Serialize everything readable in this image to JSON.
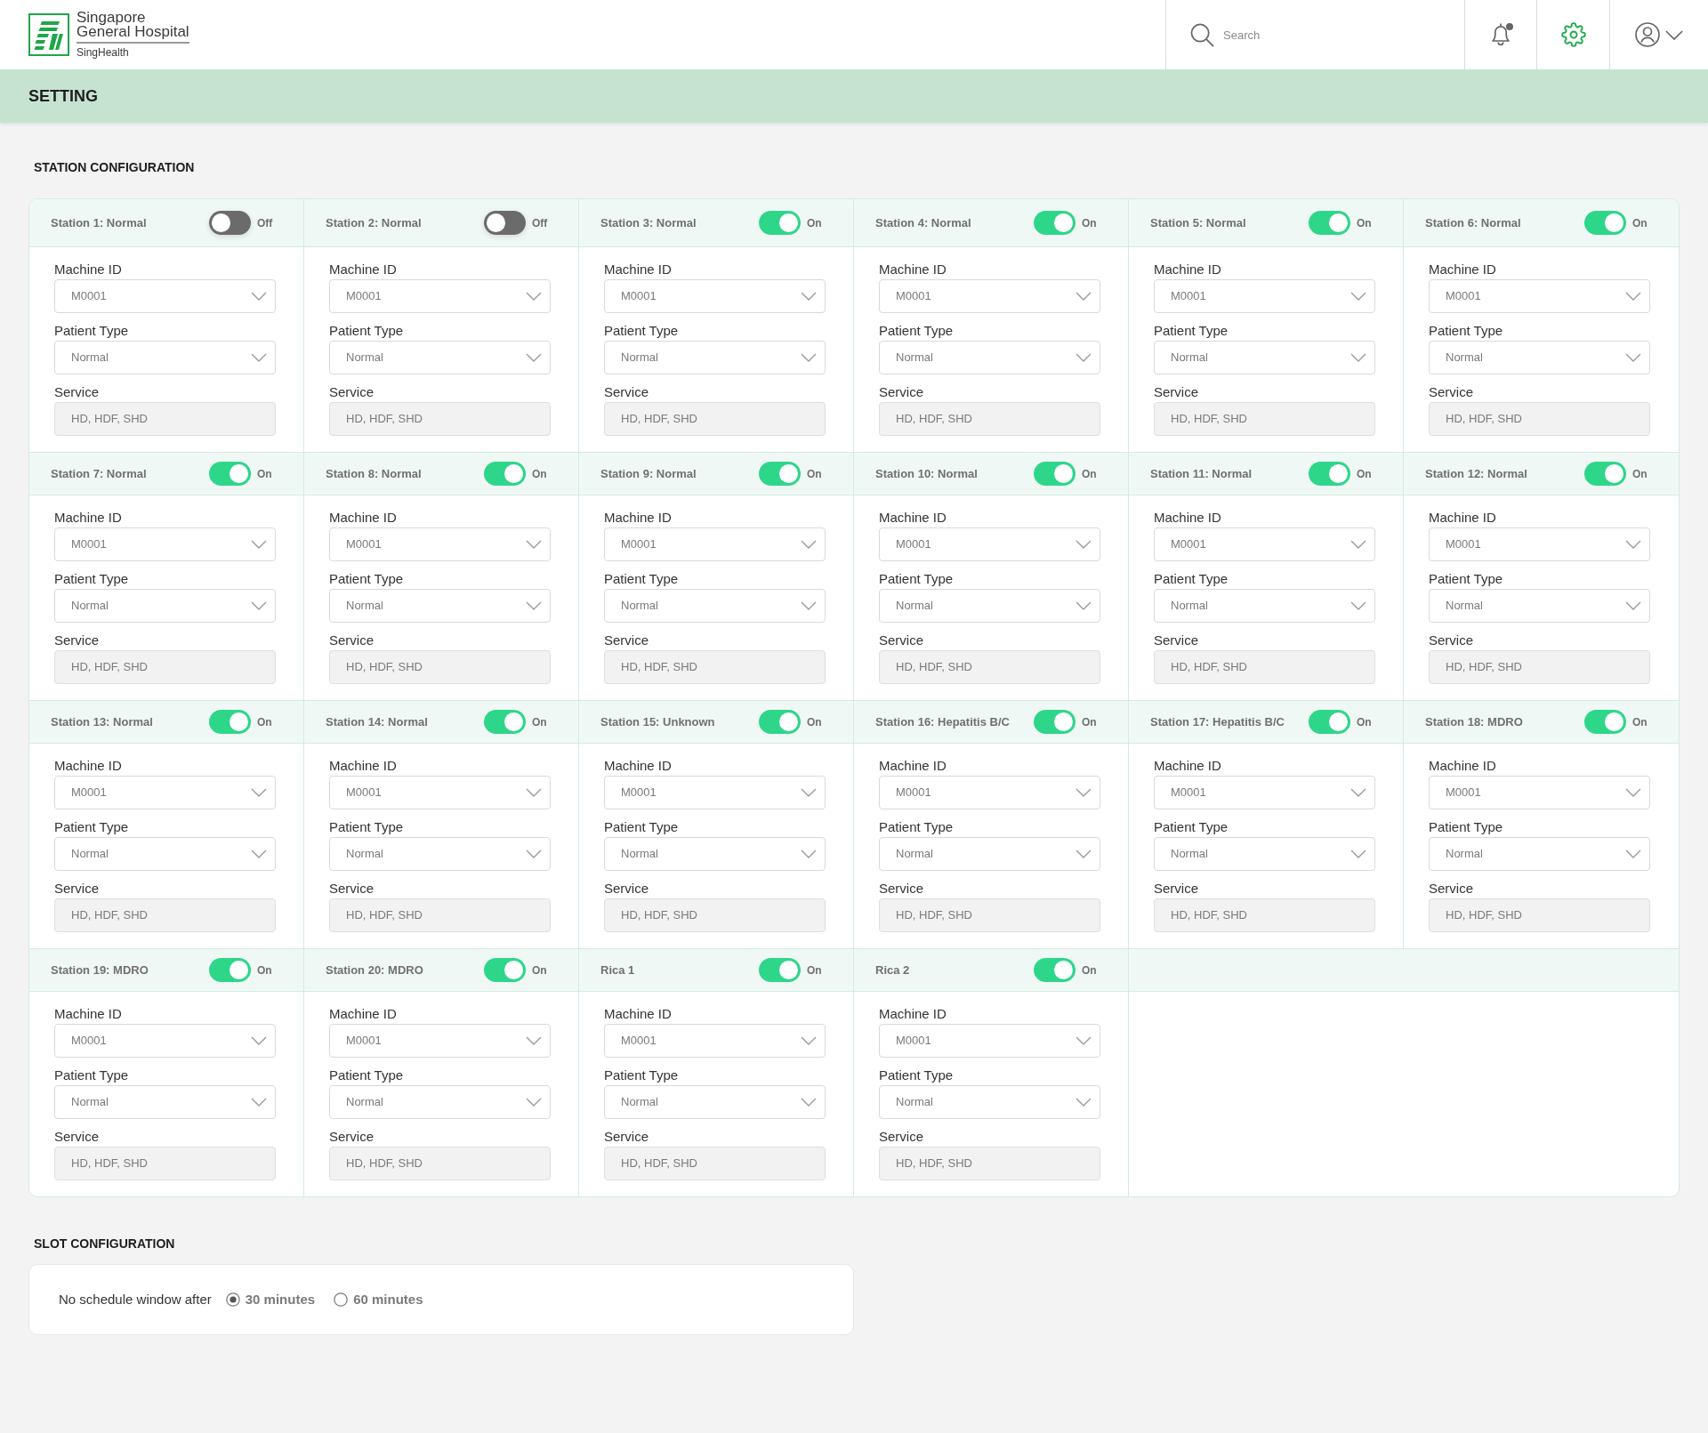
{
  "header": {
    "logo": {
      "name_lines": [
        "Singapore",
        "General Hospital"
      ],
      "group": "SingHealth"
    },
    "search": {
      "placeholder": "Search"
    },
    "actions": [
      {
        "kind": "notifications",
        "selected": false,
        "unread": true
      },
      {
        "kind": "settings",
        "selected": true,
        "unread": false
      },
      {
        "kind": "account",
        "selected": false,
        "unread": false
      }
    ]
  },
  "page_title": "SETTING",
  "station_configuration": {
    "title": "STATION CONFIGURATION",
    "stations": [
      {
        "name": "Station 1: Normal",
        "on": false,
        "toggle_label": "Off",
        "fields": [
          {
            "kind": "select",
            "label": "Machine ID",
            "value": "M0001"
          },
          {
            "kind": "select",
            "label": "Patient Type",
            "value": "Normal"
          },
          {
            "kind": "readonly",
            "label": "Service",
            "value": "HD, HDF, SHD"
          }
        ]
      },
      {
        "name": "Station 2: Normal",
        "on": false,
        "toggle_label": "Off",
        "fields": [
          {
            "kind": "select",
            "label": "Machine ID",
            "value": "M0001"
          },
          {
            "kind": "select",
            "label": "Patient Type",
            "value": "Normal"
          },
          {
            "kind": "readonly",
            "label": "Service",
            "value": "HD, HDF, SHD"
          }
        ]
      },
      {
        "name": "Station 3: Normal",
        "on": true,
        "toggle_label": "On",
        "fields": [
          {
            "kind": "select",
            "label": "Machine ID",
            "value": "M0001"
          },
          {
            "kind": "select",
            "label": "Patient Type",
            "value": "Normal"
          },
          {
            "kind": "readonly",
            "label": "Service",
            "value": "HD, HDF, SHD"
          }
        ]
      },
      {
        "name": "Station 4: Normal",
        "on": true,
        "toggle_label": "On",
        "fields": [
          {
            "kind": "select",
            "label": "Machine ID",
            "value": "M0001"
          },
          {
            "kind": "select",
            "label": "Patient Type",
            "value": "Normal"
          },
          {
            "kind": "readonly",
            "label": "Service",
            "value": "HD, HDF, SHD"
          }
        ]
      },
      {
        "name": "Station 5: Normal",
        "on": true,
        "toggle_label": "On",
        "fields": [
          {
            "kind": "select",
            "label": "Machine ID",
            "value": "M0001"
          },
          {
            "kind": "select",
            "label": "Patient Type",
            "value": "Normal"
          },
          {
            "kind": "readonly",
            "label": "Service",
            "value": "HD, HDF, SHD"
          }
        ]
      },
      {
        "name": "Station 6: Normal",
        "on": true,
        "toggle_label": "On",
        "fields": [
          {
            "kind": "select",
            "label": "Machine ID",
            "value": "M0001"
          },
          {
            "kind": "select",
            "label": "Patient Type",
            "value": "Normal"
          },
          {
            "kind": "readonly",
            "label": "Service",
            "value": "HD, HDF, SHD"
          }
        ]
      },
      {
        "name": "Station 7: Normal",
        "on": true,
        "toggle_label": "On",
        "fields": [
          {
            "kind": "select",
            "label": "Machine ID",
            "value": "M0001"
          },
          {
            "kind": "select",
            "label": "Patient Type",
            "value": "Normal"
          },
          {
            "kind": "readonly",
            "label": "Service",
            "value": "HD, HDF, SHD"
          }
        ]
      },
      {
        "name": "Station 8: Normal",
        "on": true,
        "toggle_label": "On",
        "fields": [
          {
            "kind": "select",
            "label": "Machine ID",
            "value": "M0001"
          },
          {
            "kind": "select",
            "label": "Patient Type",
            "value": "Normal"
          },
          {
            "kind": "readonly",
            "label": "Service",
            "value": "HD, HDF, SHD"
          }
        ]
      },
      {
        "name": "Station 9: Normal",
        "on": true,
        "toggle_label": "On",
        "fields": [
          {
            "kind": "select",
            "label": "Machine ID",
            "value": "M0001"
          },
          {
            "kind": "select",
            "label": "Patient Type",
            "value": "Normal"
          },
          {
            "kind": "readonly",
            "label": "Service",
            "value": "HD, HDF, SHD"
          }
        ]
      },
      {
        "name": "Station 10: Normal",
        "on": true,
        "toggle_label": "On",
        "fields": [
          {
            "kind": "select",
            "label": "Machine ID",
            "value": "M0001"
          },
          {
            "kind": "select",
            "label": "Patient Type",
            "value": "Normal"
          },
          {
            "kind": "readonly",
            "label": "Service",
            "value": "HD, HDF, SHD"
          }
        ]
      },
      {
        "name": "Station 11: Normal",
        "on": true,
        "toggle_label": "On",
        "fields": [
          {
            "kind": "select",
            "label": "Machine ID",
            "value": "M0001"
          },
          {
            "kind": "select",
            "label": "Patient Type",
            "value": "Normal"
          },
          {
            "kind": "readonly",
            "label": "Service",
            "value": "HD, HDF, SHD"
          }
        ]
      },
      {
        "name": "Station 12: Normal",
        "on": true,
        "toggle_label": "On",
        "fields": [
          {
            "kind": "select",
            "label": "Machine ID",
            "value": "M0001"
          },
          {
            "kind": "select",
            "label": "Patient Type",
            "value": "Normal"
          },
          {
            "kind": "readonly",
            "label": "Service",
            "value": "HD, HDF, SHD"
          }
        ]
      },
      {
        "name": "Station 13: Normal",
        "on": true,
        "toggle_label": "On",
        "fields": [
          {
            "kind": "select",
            "label": "Machine ID",
            "value": "M0001"
          },
          {
            "kind": "select",
            "label": "Patient Type",
            "value": "Normal"
          },
          {
            "kind": "readonly",
            "label": "Service",
            "value": "HD, HDF, SHD"
          }
        ]
      },
      {
        "name": "Station 14: Normal",
        "on": true,
        "toggle_label": "On",
        "fields": [
          {
            "kind": "select",
            "label": "Machine ID",
            "value": "M0001"
          },
          {
            "kind": "select",
            "label": "Patient Type",
            "value": "Normal"
          },
          {
            "kind": "readonly",
            "label": "Service",
            "value": "HD, HDF, SHD"
          }
        ]
      },
      {
        "name": "Station 15: Unknown",
        "on": true,
        "toggle_label": "On",
        "fields": [
          {
            "kind": "select",
            "label": "Machine ID",
            "value": "M0001"
          },
          {
            "kind": "select",
            "label": "Patient Type",
            "value": "Normal"
          },
          {
            "kind": "readonly",
            "label": "Service",
            "value": "HD, HDF, SHD"
          }
        ]
      },
      {
        "name": "Station 16: Hepatitis B/C",
        "on": true,
        "toggle_label": "On",
        "fields": [
          {
            "kind": "select",
            "label": "Machine ID",
            "value": "M0001"
          },
          {
            "kind": "select",
            "label": "Patient Type",
            "value": "Normal"
          },
          {
            "kind": "readonly",
            "label": "Service",
            "value": "HD, HDF, SHD"
          }
        ]
      },
      {
        "name": "Station 17: Hepatitis B/C",
        "on": true,
        "toggle_label": "On",
        "fields": [
          {
            "kind": "select",
            "label": "Machine ID",
            "value": "M0001"
          },
          {
            "kind": "select",
            "label": "Patient Type",
            "value": "Normal"
          },
          {
            "kind": "readonly",
            "label": "Service",
            "value": "HD, HDF, SHD"
          }
        ]
      },
      {
        "name": "Station 18: MDRO",
        "on": true,
        "toggle_label": "On",
        "fields": [
          {
            "kind": "select",
            "label": "Machine ID",
            "value": "M0001"
          },
          {
            "kind": "select",
            "label": "Patient Type",
            "value": "Normal"
          },
          {
            "kind": "readonly",
            "label": "Service",
            "value": "HD, HDF, SHD"
          }
        ]
      },
      {
        "name": "Station 19: MDRO",
        "on": true,
        "toggle_label": "On",
        "fields": [
          {
            "kind": "select",
            "label": "Machine ID",
            "value": "M0001"
          },
          {
            "kind": "select",
            "label": "Patient Type",
            "value": "Normal"
          },
          {
            "kind": "readonly",
            "label": "Service",
            "value": "HD, HDF, SHD"
          }
        ]
      },
      {
        "name": "Station 20: MDRO",
        "on": true,
        "toggle_label": "On",
        "fields": [
          {
            "kind": "select",
            "label": "Machine ID",
            "value": "M0001"
          },
          {
            "kind": "select",
            "label": "Patient Type",
            "value": "Normal"
          },
          {
            "kind": "readonly",
            "label": "Service",
            "value": "HD, HDF, SHD"
          }
        ]
      },
      {
        "name": "Rica 1",
        "on": true,
        "toggle_label": "On",
        "fields": [
          {
            "kind": "select",
            "label": "Machine ID",
            "value": "M0001"
          },
          {
            "kind": "select",
            "label": "Patient Type",
            "value": "Normal"
          },
          {
            "kind": "readonly",
            "label": "Service",
            "value": "HD, HDF, SHD"
          }
        ]
      },
      {
        "name": "Rica 2",
        "on": true,
        "toggle_label": "On",
        "fields": [
          {
            "kind": "select",
            "label": "Machine ID",
            "value": "M0001"
          },
          {
            "kind": "select",
            "label": "Patient Type",
            "value": "Normal"
          },
          {
            "kind": "readonly",
            "label": "Service",
            "value": "HD, HDF, SHD"
          }
        ]
      }
    ]
  },
  "slot_configuration": {
    "title": "SLOT CONFIGURATION",
    "label": "No schedule window after",
    "options": [
      {
        "label": "30 minutes",
        "selected": true
      },
      {
        "label": "60 minutes",
        "selected": false
      }
    ]
  }
}
